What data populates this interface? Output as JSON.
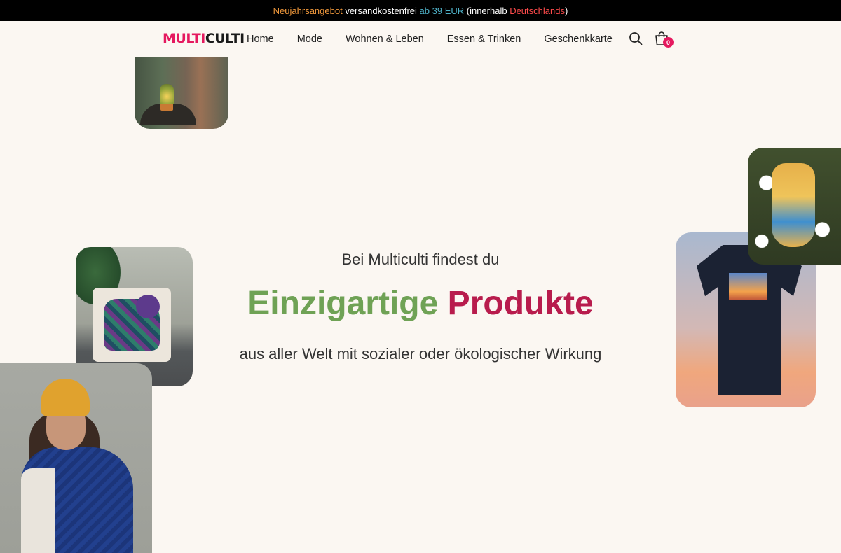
{
  "announcement": {
    "part1": "Neujahrsangebot",
    "part2": " versandkostenfrei ",
    "part3": "ab 39 EUR",
    "part4": " (innerhalb ",
    "part5": "Deutschlands",
    "part6": ")"
  },
  "header": {
    "logo_part1": "MULTI",
    "logo_part2": "CULTI",
    "nav": [
      "Home",
      "Mode",
      "Wohnen & Leben",
      "Essen & Trinken",
      "Geschenkkarte"
    ],
    "cart_count": "0",
    "icons": [
      "search-icon",
      "cart-icon"
    ]
  },
  "hero": {
    "kicker": "Bei Multiculti findest du",
    "title_word1": "Einzigartige",
    "title_word2": "Produkte",
    "subtitle": "aus aller Welt mit sozialer oder ökologischer Wirkung"
  },
  "colors": {
    "accent_pink": "#e5195f",
    "title_green": "#6fa255",
    "title_red": "#b81c4d",
    "background": "#fbf7f2"
  }
}
